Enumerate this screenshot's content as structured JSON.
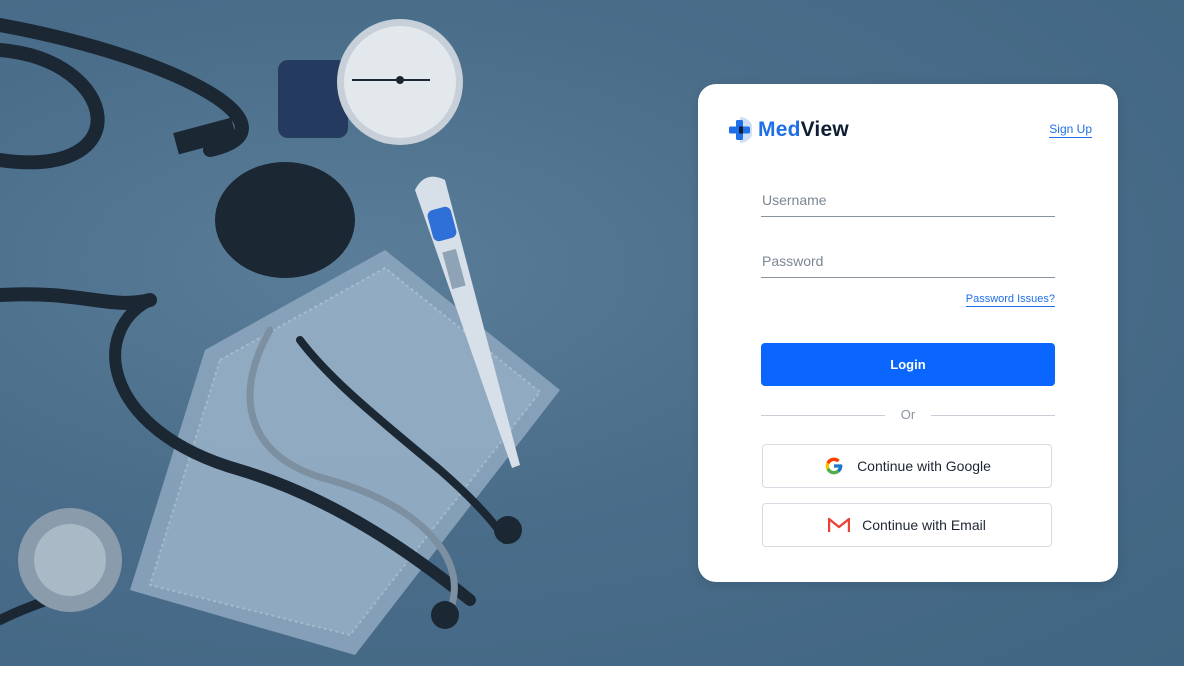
{
  "brand": {
    "part1": "Med",
    "part2": "View",
    "accent_color": "#1f6fe8"
  },
  "header": {
    "signup_label": "Sign Up"
  },
  "form": {
    "username_placeholder": "Username",
    "password_placeholder": "Password",
    "password_issues_label": "Password Issues?",
    "login_label": "Login",
    "divider_label": "Or"
  },
  "social": {
    "google_label": "Continue with Google",
    "email_label": "Continue with Email"
  },
  "background": {
    "description_icons": [
      "stethoscope-icon",
      "blood-pressure-gauge-icon",
      "thermometer-icon",
      "face-mask-icon"
    ]
  }
}
